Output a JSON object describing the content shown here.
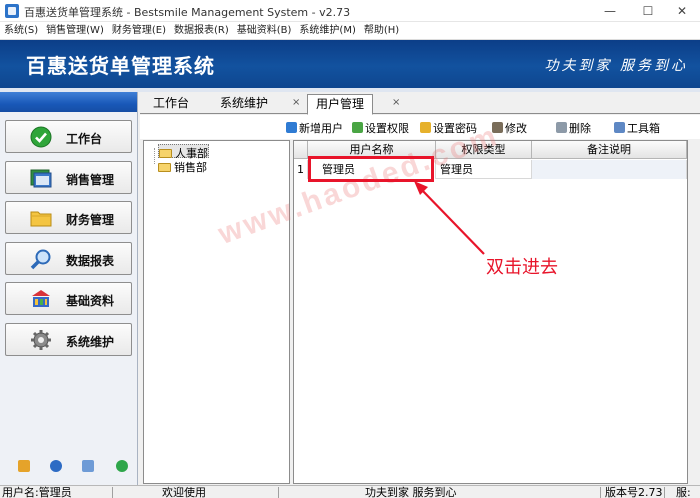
{
  "window": {
    "title": "百惠送货单管理系统 - Bestsmile Management System - v2.73",
    "minimize": "—",
    "maximize": "☐",
    "close": "✕"
  },
  "menu": [
    "系统(S)",
    "销售管理(W)",
    "财务管理(E)",
    "数据报表(R)",
    "基础资料(B)",
    "系统维护(M)",
    "帮助(H)"
  ],
  "banner": {
    "title": "百惠送货单管理系统",
    "slogan": "功夫到家 服务到心"
  },
  "nav": [
    {
      "label": "工作台",
      "icon": "check-icon"
    },
    {
      "label": "销售管理",
      "icon": "window-icon"
    },
    {
      "label": "财务管理",
      "icon": "folder-icon"
    },
    {
      "label": "数据报表",
      "icon": "magnifier-icon"
    },
    {
      "label": "基础资料",
      "icon": "building-icon"
    },
    {
      "label": "系统维护",
      "icon": "gear-icon"
    }
  ],
  "tabs": [
    {
      "label": "工作台"
    },
    {
      "label": "系统维护",
      "close": "×"
    },
    {
      "label": "用户管理",
      "close": "×"
    }
  ],
  "toolbar": [
    "新增用户",
    "设置权限",
    "设置密码",
    "修改",
    "删除",
    "工具箱"
  ],
  "tree": [
    "人事部",
    "销售部"
  ],
  "grid": {
    "headers": [
      "用户名称",
      "权限类型",
      "备注说明"
    ],
    "rows": [
      {
        "num": "1",
        "name": "管理员",
        "type": "管理员",
        "note": ""
      }
    ]
  },
  "annotation": {
    "text": "双击进去",
    "watermark": "www.haoded.com",
    "color": "#e8142a"
  },
  "status": {
    "user": "用户名:管理员",
    "welcome": "欢迎使用",
    "slogan": "功夫到家 服务到心",
    "version": "版本号2.73",
    "service": "服:"
  }
}
